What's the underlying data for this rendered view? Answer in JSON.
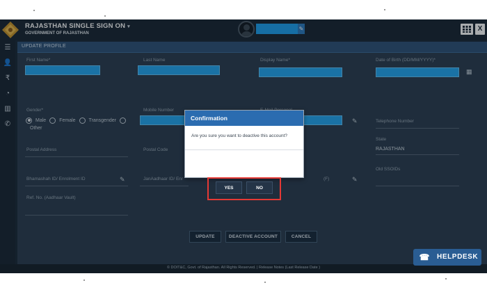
{
  "header": {
    "app_title": "RAJASTHAN SINGLE SIGN ON",
    "app_title_caret": "▾",
    "subtitle": "GOVERNMENT OF RAJASTHAN",
    "close_glyph": "X"
  },
  "sidebar": {
    "icons": [
      "list-icon",
      "user-icon",
      "rupee-icon",
      "dashboard-icon",
      "chart-icon",
      "phone-icon"
    ]
  },
  "form": {
    "title": "UPDATE PROFILE",
    "fields": {
      "first_name_label": "First Name*",
      "last_name_label": "Last Name",
      "display_name_label": "Display Name*",
      "dob_label": "Date of Birth (DD/MM/YYYY)*",
      "gender_label": "Gender*",
      "mobile_label": "Mobile Number",
      "email_label": "E-Mail Personal",
      "telephone_label": "Telephone Number",
      "postal_address_label": "Postal Address",
      "postal_code_label": "Postal Code",
      "state_label": "State",
      "state_value": "RAJASTHAN",
      "old_sso_label": "Old SSOIDs",
      "bhamashah_label": "Bhamashah ID/ Enrolment ID",
      "janaadhaar_label": "JanAadhaar ID/ Enr",
      "fourth_row_col3_label": "(F)",
      "ref_no_label": "Ref. No. (Aadhaar Vault)"
    },
    "gender_options": [
      "Male",
      "Female",
      "Transgender",
      "Other"
    ],
    "gender_selected": "Male",
    "buttons": {
      "update": "UPDATE",
      "deactivate": "DEACTIVE ACCOUNT",
      "cancel": "CANCEL"
    }
  },
  "footer": {
    "text": "© DOIT&C, Govt. of Rajasthan. All Rights Reserved.  |  Release Notes (Last Release Date )"
  },
  "helpdesk": {
    "label": "HELPDESK"
  },
  "modal": {
    "title": "Confirmation",
    "message": "Are you sure you want to deactive this account?",
    "yes": "YES",
    "no": "NO"
  },
  "colors": {
    "panel_bg": "#2b3d50",
    "header_bg": "#1a2633",
    "input_fill": "#24a6f2",
    "modal_header": "#2b6cb0",
    "highlight": "#e53935",
    "helpdesk_bg": "#2a5d93"
  }
}
